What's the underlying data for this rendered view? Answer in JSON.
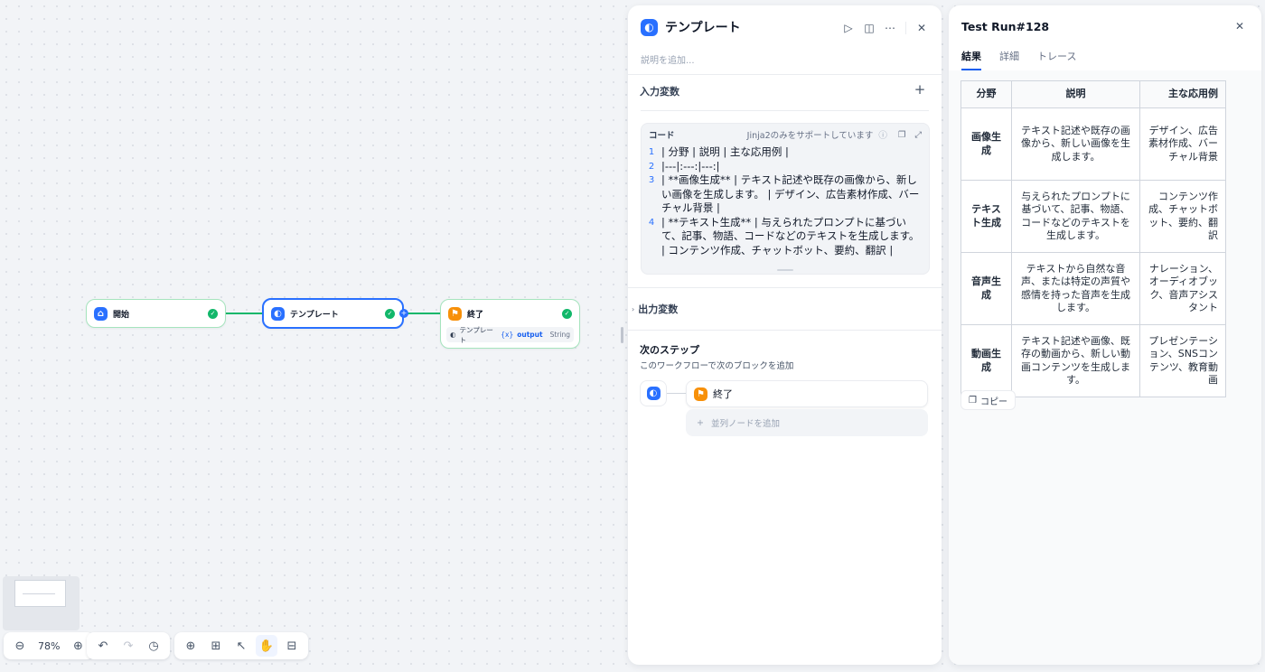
{
  "canvas": {
    "nodes": {
      "start": {
        "label": "開始"
      },
      "template": {
        "label": "テンプレート"
      },
      "end": {
        "label": "終了",
        "output_node": "テンプレート",
        "output_var": "output",
        "output_type": "String",
        "var_prefix": "{x}"
      }
    },
    "toolbar": {
      "zoom": "78%"
    }
  },
  "editor": {
    "title": "テンプレート",
    "description_placeholder": "説明を追加...",
    "input_vars_label": "入力変数",
    "code": {
      "label": "コード",
      "hint": "Jinja2のみをサポートしています",
      "lines": [
        {
          "no": "1",
          "text": "| 分野 | 説明 | 主な応用例 |"
        },
        {
          "no": "2",
          "text": "|---|:---:|---:|"
        },
        {
          "no": "3",
          "text": "| **画像生成** | テキスト記述や既存の画像から、新しい画像を生成します。 | デザイン、広告素材作成、バーチャル背景 |"
        },
        {
          "no": "4",
          "text": "| **テキスト生成** | 与えられたプロンプトに基づいて、記事、物語、コードなどのテキストを生成します。 | コンテンツ作成、チャットボット、要約、翻訳 |"
        }
      ]
    },
    "output_vars_label": "出力変数",
    "next_step": {
      "title": "次のステップ",
      "subtitle": "このワークフローで次のブロックを追加",
      "next_node": "終了",
      "add_parallel": "並列ノードを追加"
    }
  },
  "run": {
    "title": "Test Run#128",
    "tabs": [
      "結果",
      "詳細",
      "トレース"
    ],
    "table": {
      "headers": [
        "分野",
        "説明",
        "主な応用例"
      ],
      "rows": [
        [
          "画像生成",
          "テキスト記述や既存の画像から、新しい画像を生成します。",
          "デザイン、広告素材作成、バーチャル背景"
        ],
        [
          "テキスト生成",
          "与えられたプロンプトに基づいて、記事、物語、コードなどのテキストを生成します。",
          "コンテンツ作成、チャットボット、要約、翻訳"
        ],
        [
          "音声生成",
          "テキストから自然な音声、または特定の声質や感情を持った音声を生成します。",
          "ナレーション、オーディオブック、音声アシスタント"
        ],
        [
          "動画生成",
          "テキスト記述や画像、既存の動画から、新しい動画コンテンツを生成します。",
          "プレゼンテーション、SNSコンテンツ、教育動画"
        ]
      ]
    },
    "copy_label": "コピー"
  },
  "colors": {
    "accent": "#2970ff",
    "success": "#12b76a",
    "end_node": "#f79009"
  }
}
